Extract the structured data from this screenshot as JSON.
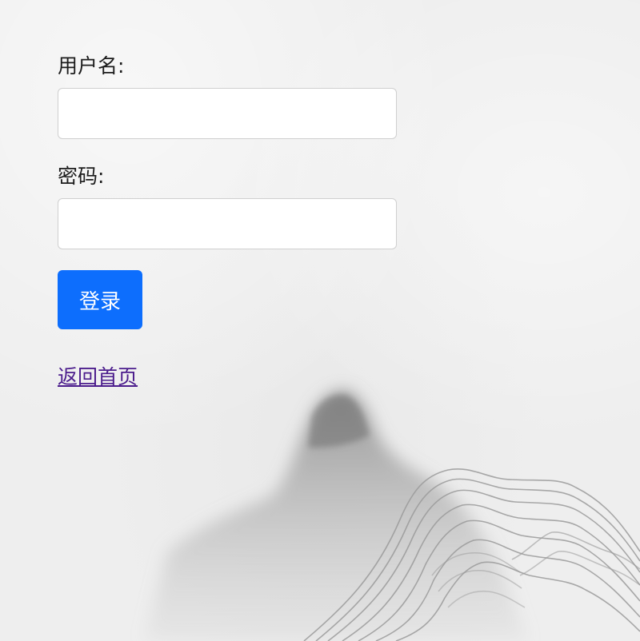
{
  "form": {
    "username_label": "用户名:",
    "username_value": "",
    "password_label": "密码:",
    "password_value": "",
    "login_button_label": "登录",
    "home_link_label": "返回首页"
  },
  "colors": {
    "button_bg": "#0d6efd",
    "button_text": "#ffffff",
    "link": "#4b1c8c",
    "background": "#eeeeee"
  },
  "background_art": {
    "description_icon": "ink-mountain-landscape"
  }
}
